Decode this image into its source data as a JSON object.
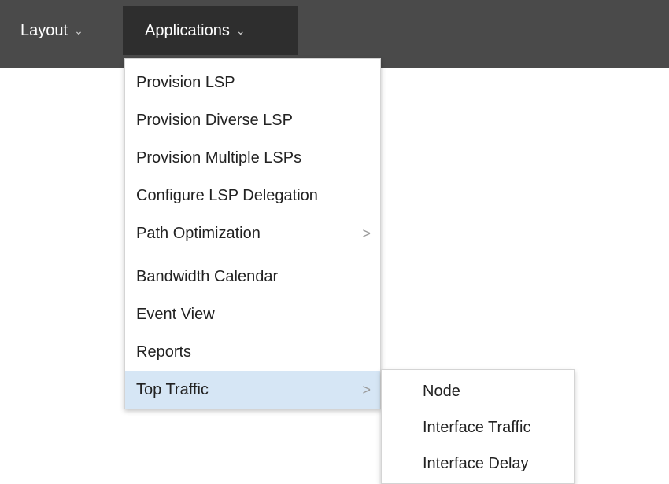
{
  "menubar": {
    "layout_label": "Layout",
    "applications_label": "Applications",
    "chevron": "⌄"
  },
  "applications_menu": {
    "group1": [
      {
        "label": "Provision LSP"
      },
      {
        "label": "Provision Diverse LSP"
      },
      {
        "label": "Provision Multiple LSPs"
      },
      {
        "label": "Configure LSP Delegation"
      },
      {
        "label": "Path Optimization",
        "submenu_arrow": ">"
      }
    ],
    "group2": [
      {
        "label": "Bandwidth Calendar"
      },
      {
        "label": "Event View"
      },
      {
        "label": "Reports"
      },
      {
        "label": "Top Traffic",
        "submenu_arrow": ">",
        "highlighted": true
      }
    ]
  },
  "top_traffic_submenu": {
    "items": [
      {
        "label": "Node"
      },
      {
        "label": "Interface Traffic"
      },
      {
        "label": "Interface Delay"
      }
    ]
  },
  "colors": {
    "menubar_bg": "#4a4a4a",
    "active_top_bg": "#2e2e2e",
    "highlight_bg": "#d6e6f5",
    "text": "#222222"
  }
}
